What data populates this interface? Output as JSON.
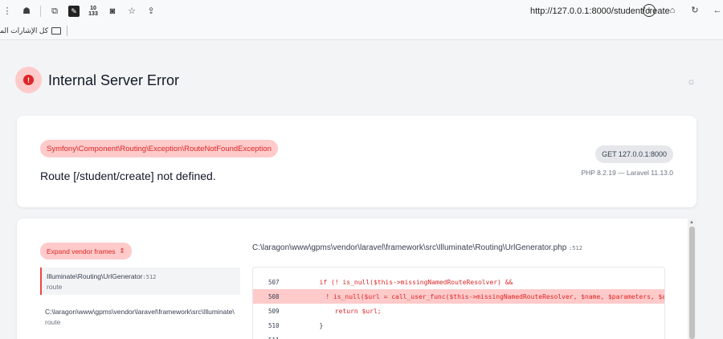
{
  "browser": {
    "url": "http://127.0.0.1:8000/student/create",
    "bookmarks_label": "كل الإشارات المرجعية",
    "badge_top": "10",
    "badge_bottom": "133"
  },
  "page": {
    "title": "Internal Server Error",
    "exception_class": "Symfony\\Component\\Routing\\Exception\\RouteNotFoundException",
    "message": "Route [/student/create] not defined.",
    "request": "GET 127.0.0.1:8000",
    "versions": "PHP 8.2.19 — Laravel 11.13.0"
  },
  "trace": {
    "expand_label": "Expand vendor frames",
    "frames": [
      {
        "path": "Illuminate\\Routing\\UrlGenerator",
        "line": ":512",
        "sub": "route"
      },
      {
        "path": "C:\\laragon\\www\\gpms\\vendor\\laravel\\framework\\src\\Illuminate\\",
        "sub": "route"
      }
    ],
    "file_path": "C:\\laragon\\www\\gpms\\vendor\\laravel\\framework\\src\\Illuminate\\Routing\\UrlGenerator.php",
    "file_line": ":512",
    "code": [
      {
        "n": "507",
        "text": "        if (! is_null($this->missingNamedRouteResolver) &&"
      },
      {
        "n": "508",
        "text": "            ! is_null($url = call_user_func($this->missingNamedRouteResolver, $name, $parameters, $ab"
      },
      {
        "n": "509",
        "text": "            return $url;"
      },
      {
        "n": "510",
        "text": "        }"
      },
      {
        "n": "511",
        "text": ""
      }
    ]
  },
  "colors": {
    "error_red": "#dc2626",
    "error_bg": "#fecaca",
    "page_bg": "#f3f4f6"
  }
}
